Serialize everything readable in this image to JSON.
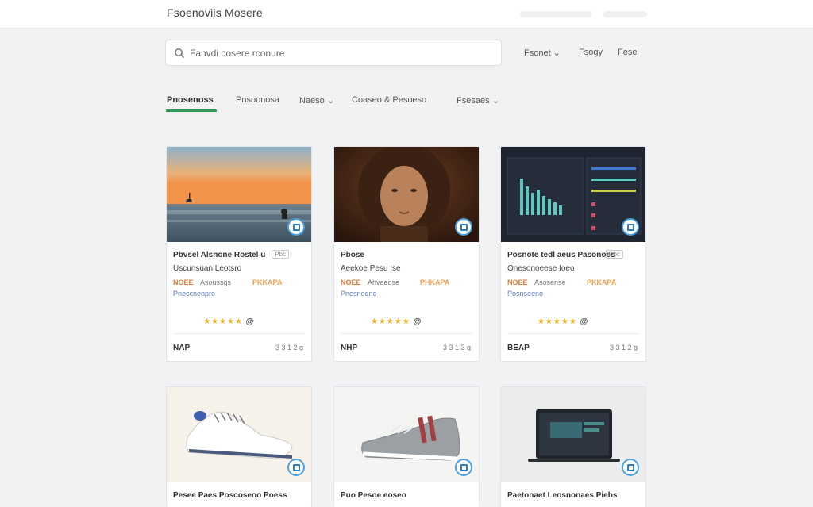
{
  "header": {
    "title": "Fsoenoviis Mosere"
  },
  "search": {
    "placeholder": "Fanvdi cosere rconure"
  },
  "header_links": [
    {
      "label": "Fsonet ⌄"
    },
    {
      "label": "Fsogy"
    },
    {
      "label": "Fese"
    }
  ],
  "tabs": [
    {
      "label": "Pnosenoss"
    },
    {
      "label": "Pnsoonosa"
    },
    {
      "label": "Naeso ⌄"
    },
    {
      "label": "Coaseo & Pesoeso"
    },
    {
      "label": "Fsesaes ⌄"
    }
  ],
  "cards": [
    {
      "title": "Pbvsel Alsnone Rostel u",
      "chip": "Pbc",
      "subtitle": "Uscunsuan Leotsro",
      "price": "NOEE",
      "meta": "Asoussgs",
      "deal": "PKKAPA",
      "tag": "Pnescnenpro",
      "stars": "★★★★★",
      "rating_mark": "@",
      "footer_left": "NAP",
      "footer_right": "3 3 1 2 g"
    },
    {
      "title": "Pbose",
      "chip": "",
      "subtitle": "Aeekoe Pesu Ise",
      "price": "NOEE",
      "meta": "Ahvaeose",
      "deal": "PHKAPA",
      "tag": "Pnesnoeno",
      "stars": "★★★★★",
      "rating_mark": "@",
      "footer_left": "NHP",
      "footer_right": "3 3 1 3 g"
    },
    {
      "title": "Posnote tedl aeus Pasonoes",
      "chip": "Dbc",
      "subtitle": "Onesonoeese Ioeo",
      "price": "NOEE",
      "meta": "Asosense",
      "deal": "PKKAPA",
      "tag": "Posnseeno",
      "stars": "★★★★★",
      "rating_mark": "@",
      "footer_left": "BEAP",
      "footer_right": "3 3 1 2 g"
    },
    {
      "title": "Pesee Paes Poscoseoo Poess"
    },
    {
      "title": "Puo Pesoe eoseo"
    },
    {
      "title": "Paetonaet Leosnonaes Piebs"
    }
  ],
  "colors": {
    "accent": "#2e9a55",
    "star": "#f2b120",
    "price": "#e07b3a",
    "badge": "#4aa3e0"
  }
}
